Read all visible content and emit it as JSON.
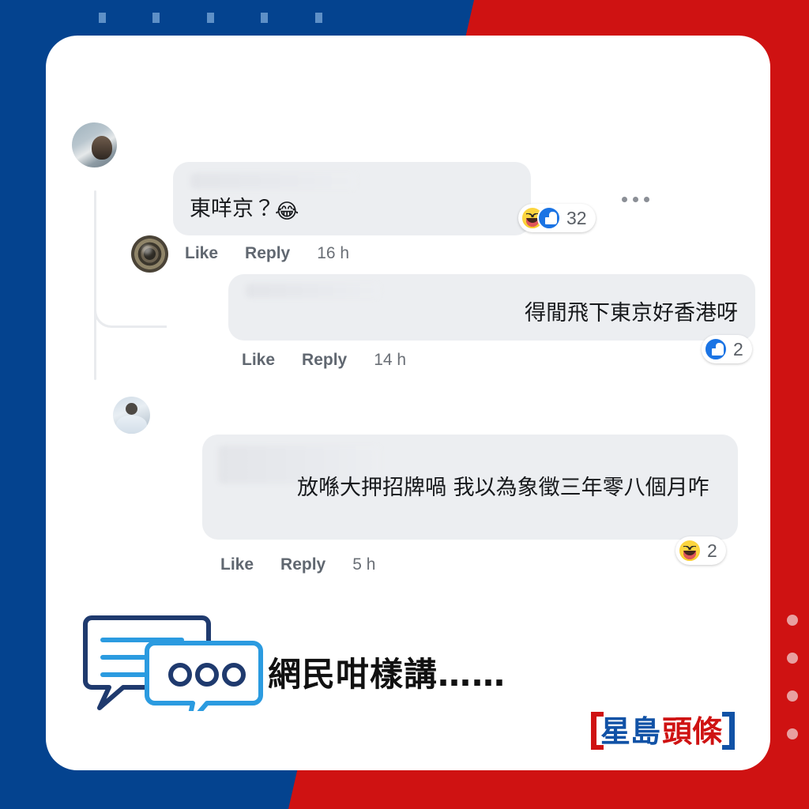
{
  "background": {
    "blue_hex": "#04438f",
    "red_hex": "#cf1212",
    "dash_count": 5,
    "dot_count": 4,
    "dot_hex": "#e8a0a0"
  },
  "card": {
    "background_hex": "#ffffff"
  },
  "comments": [
    {
      "id": "comment-1",
      "avatar_name": "avatar-user-1",
      "message": "東咩京？",
      "emoji": "😂",
      "name_hidden": true,
      "actions": {
        "like": "Like",
        "reply": "Reply",
        "time": "16 h"
      },
      "reaction": {
        "types": [
          "haha",
          "like"
        ],
        "count": "32"
      },
      "has_menu": true
    },
    {
      "id": "comment-2-reply",
      "avatar_name": "avatar-user-2",
      "message": "得閒飛下東京好香港呀",
      "emoji": "",
      "name_hidden": true,
      "actions": {
        "like": "Like",
        "reply": "Reply",
        "time": "14 h"
      },
      "reaction": {
        "types": [
          "like"
        ],
        "count": "2"
      },
      "has_menu": false
    },
    {
      "id": "comment-3",
      "avatar_name": "avatar-user-3",
      "message": "放喺大押招牌喎 我以為象徵三年零八個月咋",
      "emoji": "",
      "name_hidden": true,
      "actions": {
        "like": "Like",
        "reply": "Reply",
        "time": "5 h"
      },
      "reaction": {
        "types": [
          "haha"
        ],
        "count": "2"
      },
      "has_menu": false
    }
  ],
  "footer": {
    "tagline": "網民咁樣講……",
    "speech_bubble_dark_hex": "#1f3a6e",
    "speech_bubble_light_hex": "#2b9be0"
  },
  "logo": {
    "text_blue": "星島",
    "text_red": "頭條",
    "blue_hex": "#1152a6",
    "red_hex": "#cf1212"
  }
}
